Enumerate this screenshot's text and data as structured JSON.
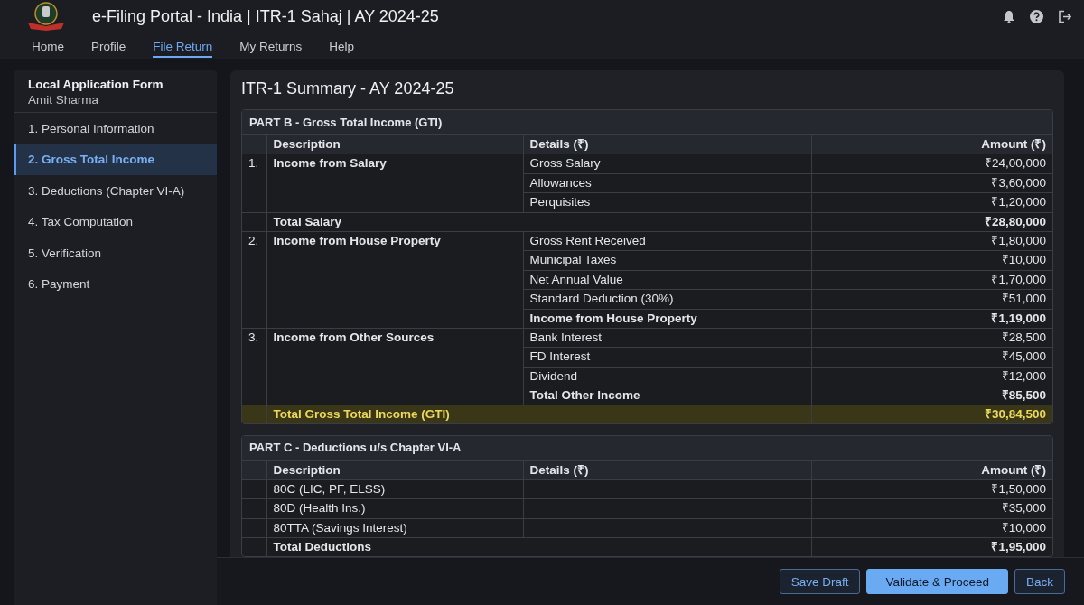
{
  "header": {
    "title": "e-Filing Portal - India | ITR-1 Sahaj | AY 2024-25"
  },
  "nav": [
    {
      "label": "Home",
      "selected": false
    },
    {
      "label": "Profile",
      "selected": false
    },
    {
      "label": "File Return",
      "selected": true
    },
    {
      "label": "My Returns",
      "selected": false
    },
    {
      "label": "Help",
      "selected": false
    }
  ],
  "sidebar": {
    "title": "Local Application Form",
    "subtitle": "Amit Sharma",
    "items": [
      {
        "label": "1. Personal Information",
        "selected": false
      },
      {
        "label": "2. Gross Total Income",
        "selected": true
      },
      {
        "label": "3. Deductions (Chapter VI-A)",
        "selected": false
      },
      {
        "label": "4. Tax Computation",
        "selected": false
      },
      {
        "label": "5. Verification",
        "selected": false
      },
      {
        "label": "6. Payment",
        "selected": false
      }
    ]
  },
  "main": {
    "title": "ITR-1 Summary - AY 2024-25",
    "parts": [
      {
        "title": "PART B - Gross Total Income (GTI)",
        "columns": [
          "Description",
          "Details (₹)",
          "Amount (₹)"
        ],
        "rows": [
          {
            "kind": "group",
            "index": "1.",
            "description": "Income from Salary",
            "items": [
              {
                "label": "Gross Salary",
                "amount": "₹24,00,000",
                "bold": false
              },
              {
                "label": "Allowances",
                "amount": "₹3,60,000",
                "bold": false
              },
              {
                "label": "Perquisites",
                "amount": "₹1,20,000",
                "bold": false
              }
            ]
          },
          {
            "kind": "total",
            "description": "Total Salary",
            "amount": "₹28,80,000"
          },
          {
            "kind": "group",
            "index": "2.",
            "description": "Income from House Property",
            "items": [
              {
                "label": "Gross Rent Received",
                "amount": "₹1,80,000",
                "bold": false
              },
              {
                "label": "Municipal Taxes",
                "amount": "₹10,000",
                "bold": false
              },
              {
                "label": "Net Annual Value",
                "amount": "₹1,70,000",
                "bold": false
              },
              {
                "label": "Standard Deduction (30%)",
                "amount": "₹51,000",
                "bold": false
              },
              {
                "label": "Income from House Property",
                "amount": "₹1,19,000",
                "bold": true
              }
            ]
          },
          {
            "kind": "group",
            "index": "3.",
            "description": "Income from Other Sources",
            "items": [
              {
                "label": "Bank Interest",
                "amount": "₹28,500",
                "bold": false
              },
              {
                "label": "FD Interest",
                "amount": "₹45,000",
                "bold": false
              },
              {
                "label": "Dividend",
                "amount": "₹12,000",
                "bold": false
              },
              {
                "label": "Total Other Income",
                "amount": "₹85,500",
                "bold": true
              }
            ]
          },
          {
            "kind": "grand",
            "description": "Total Gross Total Income (GTI)",
            "amount": "₹30,84,500"
          }
        ]
      },
      {
        "title": "PART C - Deductions u/s Chapter VI-A",
        "columns": [
          "Description",
          "Details (₹)",
          "Amount (₹)"
        ],
        "rows": [
          {
            "kind": "line",
            "description": "80C (LIC, PF, ELSS)",
            "amount": "₹1,50,000"
          },
          {
            "kind": "line",
            "description": "80D (Health Ins.)",
            "amount": "₹35,000"
          },
          {
            "kind": "line",
            "description": "80TTA (Savings Interest)",
            "amount": "₹10,000"
          },
          {
            "kind": "total",
            "description": "Total Deductions",
            "amount": "₹1,95,000"
          }
        ]
      }
    ]
  },
  "actions": [
    {
      "label": "Save Draft",
      "kind": "secondary"
    },
    {
      "label": "Validate & Proceed",
      "kind": "primary"
    },
    {
      "label": "Back",
      "kind": "secondary"
    }
  ]
}
